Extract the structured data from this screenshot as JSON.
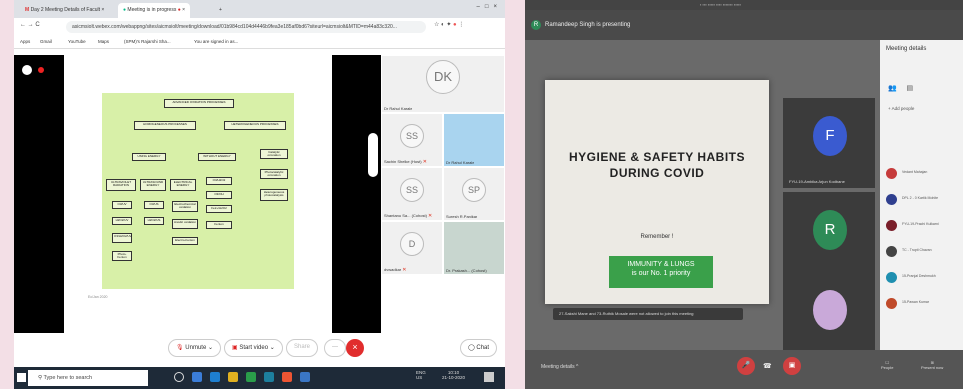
{
  "left": {
    "tabs": [
      {
        "label": "Day 2 Meeting Details of Facult"
      },
      {
        "label": "Meeting is in progress"
      }
    ],
    "new_tab": "+",
    "url": "asicmsiolt.webex.com/webappng/sites/aicmsiolt/meeting/download/01b984cd104d4446b9fea3e185af0bd6?siteurl=aicmsiolt&MTID=m44a83c320...",
    "bookmarks": [
      "Apps",
      "Gmail",
      "YouTube",
      "Maps",
      "(SPM)'s Rajarshi Sha...",
      "You are signed in as..."
    ],
    "slide": {
      "footnote": "Ec/Jan 2020",
      "nodes": [
        "ADVANCED OXIDATION PROCESSES",
        "HOMOGENEOUS PROCESSES",
        "HETEROGENEOUS PROCESSES",
        "USING ENERGY",
        "WITHOUT ENERGY",
        "Catalytic ozonation",
        "Photocatalytic ozonation",
        "Heterogeneous photocatalysis",
        "ULTRAVIOLET RADIATION",
        "ULTRASOUND ENERGY",
        "ELECTRICAL ENERGY",
        "O3/H2O2",
        "O3/OH",
        "O3/UV",
        "O3/US",
        "Electrochemical oxidation",
        "H2O2/UV",
        "Fe2+/H2O2",
        "O3/H2O2/UV",
        "H2O2/US",
        "Anodic oxidation",
        "Photo-Fenton",
        "Electro-Fenton",
        "Fenton"
      ]
    },
    "participants": [
      {
        "initials": "DK",
        "name": "Dr Rahul Karale",
        "muted": false
      },
      {
        "initials": "SS",
        "name": "Sachin Shelke (Host)",
        "muted": true
      },
      {
        "initials": "",
        "name": "Dr Rahul Karale",
        "muted": false
      },
      {
        "initials": "SS",
        "name": "Shantanu Sa... (Cohost)",
        "muted": true
      },
      {
        "initials": "SP",
        "name": "Suresh R.Panikar",
        "muted": false
      },
      {
        "initials": "D",
        "name": "dvwadkar",
        "muted": true
      },
      {
        "initials": "",
        "name": "Dr. Prakash... (Cohost)",
        "muted": false
      }
    ],
    "controls": {
      "unmute": "Unmute",
      "start_video": "Start video",
      "share": "Share",
      "more": "···",
      "end": "×",
      "chat": "Chat"
    },
    "taskbar": {
      "search": "Type here to search",
      "lang": "ENG",
      "region": "US",
      "time": "10:10",
      "date": "21-10-2020"
    }
  },
  "right": {
    "presenter": "Ramandeep Singh is presenting",
    "slide": {
      "title_line1": "HYGIENE & SAFETY HABITS",
      "title_line2": "DURING COVID",
      "remember": "Remember !",
      "box_line1": "IMMUNITY & LUNGS",
      "box_line2": "is our No. 1 priority"
    },
    "blocked_notice": "27-Sakshi Mane and 73-Ruthik Mosale were not allowed to join this meeting",
    "participants": [
      {
        "initial": "F",
        "name": "FYU-19-Ambika Arjun Kodbane",
        "color": "#3a5bd0"
      },
      {
        "initial": "R",
        "name": "Ramandeep Singh",
        "color": "#2e8b57"
      },
      {
        "initial": "",
        "name": "FYU-19-Mrunali Bhushan Mane",
        "color": "#8a6aa0"
      }
    ],
    "side": {
      "title": "Meeting details",
      "add_people": "Add people",
      "rows": [
        {
          "name": "Vedant Mahajan",
          "color": "#c63b3b"
        },
        {
          "name": "DPL 2 - 0 Kartik Mohite",
          "color": "#2f3f8f"
        },
        {
          "name": "FYU-19-Prachi Kulkarni",
          "color": "#7a1f2a"
        },
        {
          "name": "TC - Trupti Chavan",
          "color": "#444"
        },
        {
          "name": "15-Pranjal Deshmukh",
          "color": "#1f8fb0"
        },
        {
          "name": "15-Pawan Kumar",
          "color": "#c04a2a"
        }
      ]
    },
    "bottom": {
      "meeting_details": "Meeting details",
      "people": "People",
      "present": "Present now"
    }
  }
}
